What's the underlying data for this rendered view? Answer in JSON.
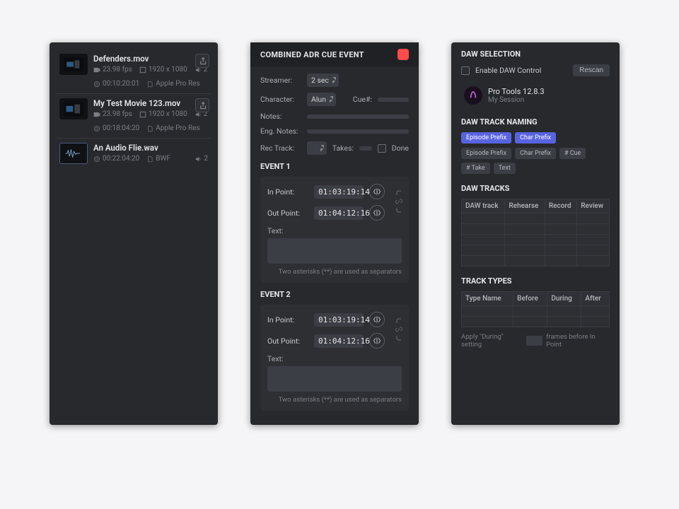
{
  "files": {
    "0": {
      "name": "Defenders.mov",
      "fps": "23.98 fps",
      "res": "1920 x 1080",
      "ch": "2",
      "dur": "00:10:20:01",
      "codec": "Apple Pro Res"
    },
    "1": {
      "name": "My Test Movie 123.mov",
      "fps": "23.98 fps",
      "res": "1920 x 1080",
      "ch": "2",
      "dur": "00:18:04:20",
      "codec": "Apple Pro Res"
    },
    "2": {
      "name": "An Audio Flie.wav",
      "dur": "00:22:04:20",
      "codec": "BWF",
      "ch": "2"
    }
  },
  "cue": {
    "title": "COMBINED ADR CUE EVENT",
    "streamer_label": "Streamer:",
    "streamer_value": "2 sec",
    "character_label": "Character:",
    "character_value": "Alun",
    "cueno_label": "Cue#:",
    "notes_label": "Notes:",
    "engnotes_label": "Eng. Notes:",
    "rectrack_label": "Rec Track:",
    "takes_label": "Takes:",
    "done_label": "Done",
    "event1_title": "EVENT 1",
    "event2_title": "EVENT 2",
    "in_label": "In Point:",
    "out_label": "Out Point:",
    "text_label": "Text:",
    "hint": "Two asterisks (**) are used as separators",
    "e1_in": "01:03:19:14",
    "e1_out": "01:04:12:16",
    "e2_in": "01:03:19:14",
    "e2_out": "01:04:12:16"
  },
  "daw": {
    "selection_title": "DAW SELECTION",
    "enable_label": "Enable DAW Control",
    "rescan_label": "Rescan",
    "app_name": "Pro Tools 12.8.3",
    "session_name": "My Session",
    "naming_title": "DAW TRACK NAMING",
    "tags_hl": {
      "0": "Episode Prefix",
      "1": "Char Prefix"
    },
    "tags": {
      "0": "Episode Prefix",
      "1": "Char Prefix",
      "2": "# Cue",
      "3": "# Take",
      "4": "Text"
    },
    "tracks_title": "DAW TRACKS",
    "tracks_headers": {
      "0": "DAW track",
      "1": "Rehearse",
      "2": "Record",
      "3": "Review"
    },
    "types_title": "TRACK TYPES",
    "types_headers": {
      "0": "Type Name",
      "1": "Before",
      "2": "During",
      "3": "After"
    },
    "footer_a": "Apply \"During\" setting",
    "footer_b": "frames before In Point"
  }
}
